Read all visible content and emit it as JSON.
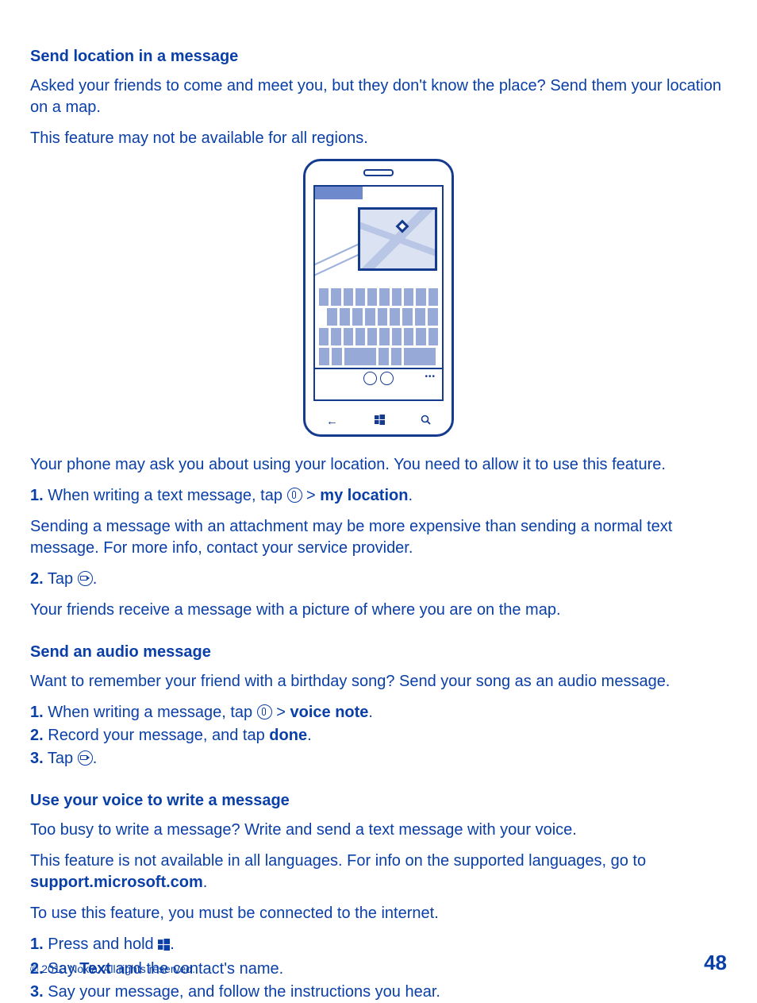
{
  "section1": {
    "heading": "Send location in a message",
    "intro": "Asked your friends to come and meet you, but they don't know the place? Send them your location on a map.",
    "availability": "This feature may not be available for all regions.",
    "allow": "Your phone may ask you about using your location. You need to allow it to use this feature.",
    "step1_num": "1.",
    "step1_a": " When writing a text message, tap ",
    "step1_b": " > ",
    "step1_bold": "my location",
    "step1_c": ".",
    "cost": "Sending a message with an attachment may be more expensive than sending a normal text message. For more info, contact your service provider.",
    "step2_num": "2.",
    "step2_a": " Tap ",
    "step2_b": ".",
    "result": "Your friends receive a message with a picture of where you are on the map."
  },
  "section2": {
    "heading": "Send an audio message",
    "intro": "Want to remember your friend with a birthday song? Send your song as an audio message.",
    "s1_num": "1.",
    "s1_a": " When writing a message, tap ",
    "s1_b": " > ",
    "s1_bold": "voice note",
    "s1_c": ".",
    "s2_num": "2.",
    "s2_a": " Record your message, and tap ",
    "s2_bold": "done",
    "s2_b": ".",
    "s3_num": "3.",
    "s3_a": " Tap ",
    "s3_b": "."
  },
  "section3": {
    "heading": "Use your voice to write a message",
    "intro": "Too busy to write a message? Write and send a text message with your voice.",
    "lang_a": "This feature is not available in all languages. For info on the supported languages, go to ",
    "lang_link": "support.microsoft.com",
    "lang_b": ".",
    "internet": "To use this feature, you must be connected to the internet.",
    "s1_num": "1.",
    "s1_a": " Press and hold ",
    "s1_b": ".",
    "s2_num": "2.",
    "s2_a": " Say ",
    "s2_bold": "Text",
    "s2_b": " and the contact's name.",
    "s3_num": "3.",
    "s3_a": " Say your message, and follow the instructions you hear."
  },
  "footer": {
    "copyright": "© 2013 Nokia. All rights reserved.",
    "page": "48"
  }
}
